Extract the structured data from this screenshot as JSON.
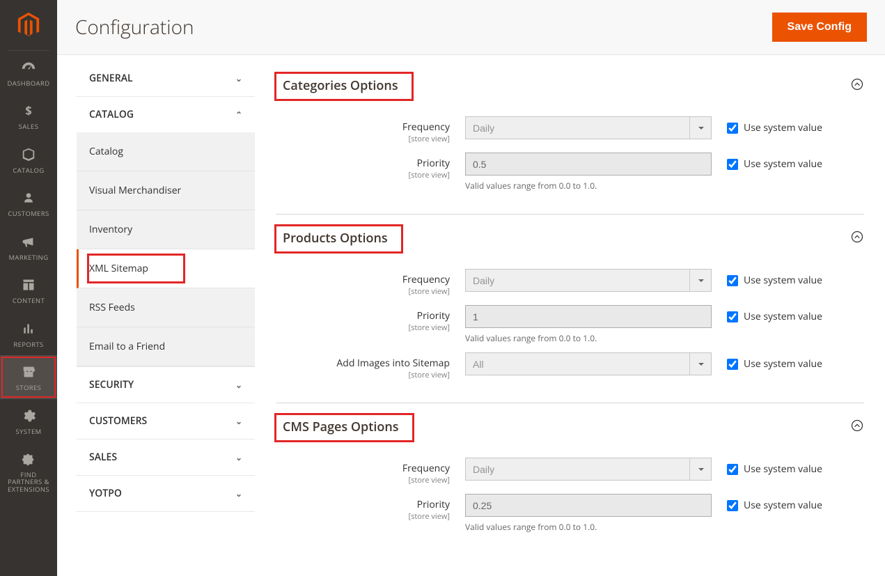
{
  "header": {
    "title": "Configuration",
    "save_button": "Save Config"
  },
  "sidebar": {
    "items": [
      {
        "key": "dashboard",
        "label": "DASHBOARD"
      },
      {
        "key": "sales",
        "label": "SALES"
      },
      {
        "key": "catalog",
        "label": "CATALOG"
      },
      {
        "key": "customers",
        "label": "CUSTOMERS"
      },
      {
        "key": "marketing",
        "label": "MARKETING"
      },
      {
        "key": "content",
        "label": "CONTENT"
      },
      {
        "key": "reports",
        "label": "REPORTS"
      },
      {
        "key": "stores",
        "label": "STORES"
      },
      {
        "key": "system",
        "label": "SYSTEM"
      },
      {
        "key": "find_partners",
        "label": "FIND PARTNERS & EXTENSIONS"
      }
    ]
  },
  "config_nav": {
    "groups": [
      {
        "label": "GENERAL",
        "expanded": false
      },
      {
        "label": "CATALOG",
        "expanded": true,
        "items": [
          {
            "label": "Catalog"
          },
          {
            "label": "Visual Merchandiser"
          },
          {
            "label": "Inventory"
          },
          {
            "label": "XML Sitemap",
            "active": true
          },
          {
            "label": "RSS Feeds"
          },
          {
            "label": "Email to a Friend"
          }
        ]
      },
      {
        "label": "SECURITY",
        "expanded": false
      },
      {
        "label": "CUSTOMERS",
        "expanded": false
      },
      {
        "label": "SALES",
        "expanded": false
      },
      {
        "label": "YOTPO",
        "expanded": false
      }
    ]
  },
  "sections": {
    "categories": {
      "title": "Categories Options",
      "frequency": {
        "label": "Frequency",
        "scope": "[store view]",
        "value": "Daily",
        "use_system": true
      },
      "priority": {
        "label": "Priority",
        "scope": "[store view]",
        "value": "0.5",
        "note": "Valid values range from 0.0 to 1.0.",
        "use_system": true
      }
    },
    "products": {
      "title": "Products Options",
      "frequency": {
        "label": "Frequency",
        "scope": "[store view]",
        "value": "Daily",
        "use_system": true
      },
      "priority": {
        "label": "Priority",
        "scope": "[store view]",
        "value": "1",
        "note": "Valid values range from 0.0 to 1.0.",
        "use_system": true
      },
      "images": {
        "label": "Add Images into Sitemap",
        "scope": "[store view]",
        "value": "All",
        "use_system": true
      }
    },
    "cms": {
      "title": "CMS Pages Options",
      "frequency": {
        "label": "Frequency",
        "scope": "[store view]",
        "value": "Daily",
        "use_system": true
      },
      "priority": {
        "label": "Priority",
        "scope": "[store view]",
        "value": "0.25",
        "note": "Valid values range from 0.0 to 1.0.",
        "use_system": true
      }
    }
  },
  "labels": {
    "use_system_value": "Use system value"
  }
}
